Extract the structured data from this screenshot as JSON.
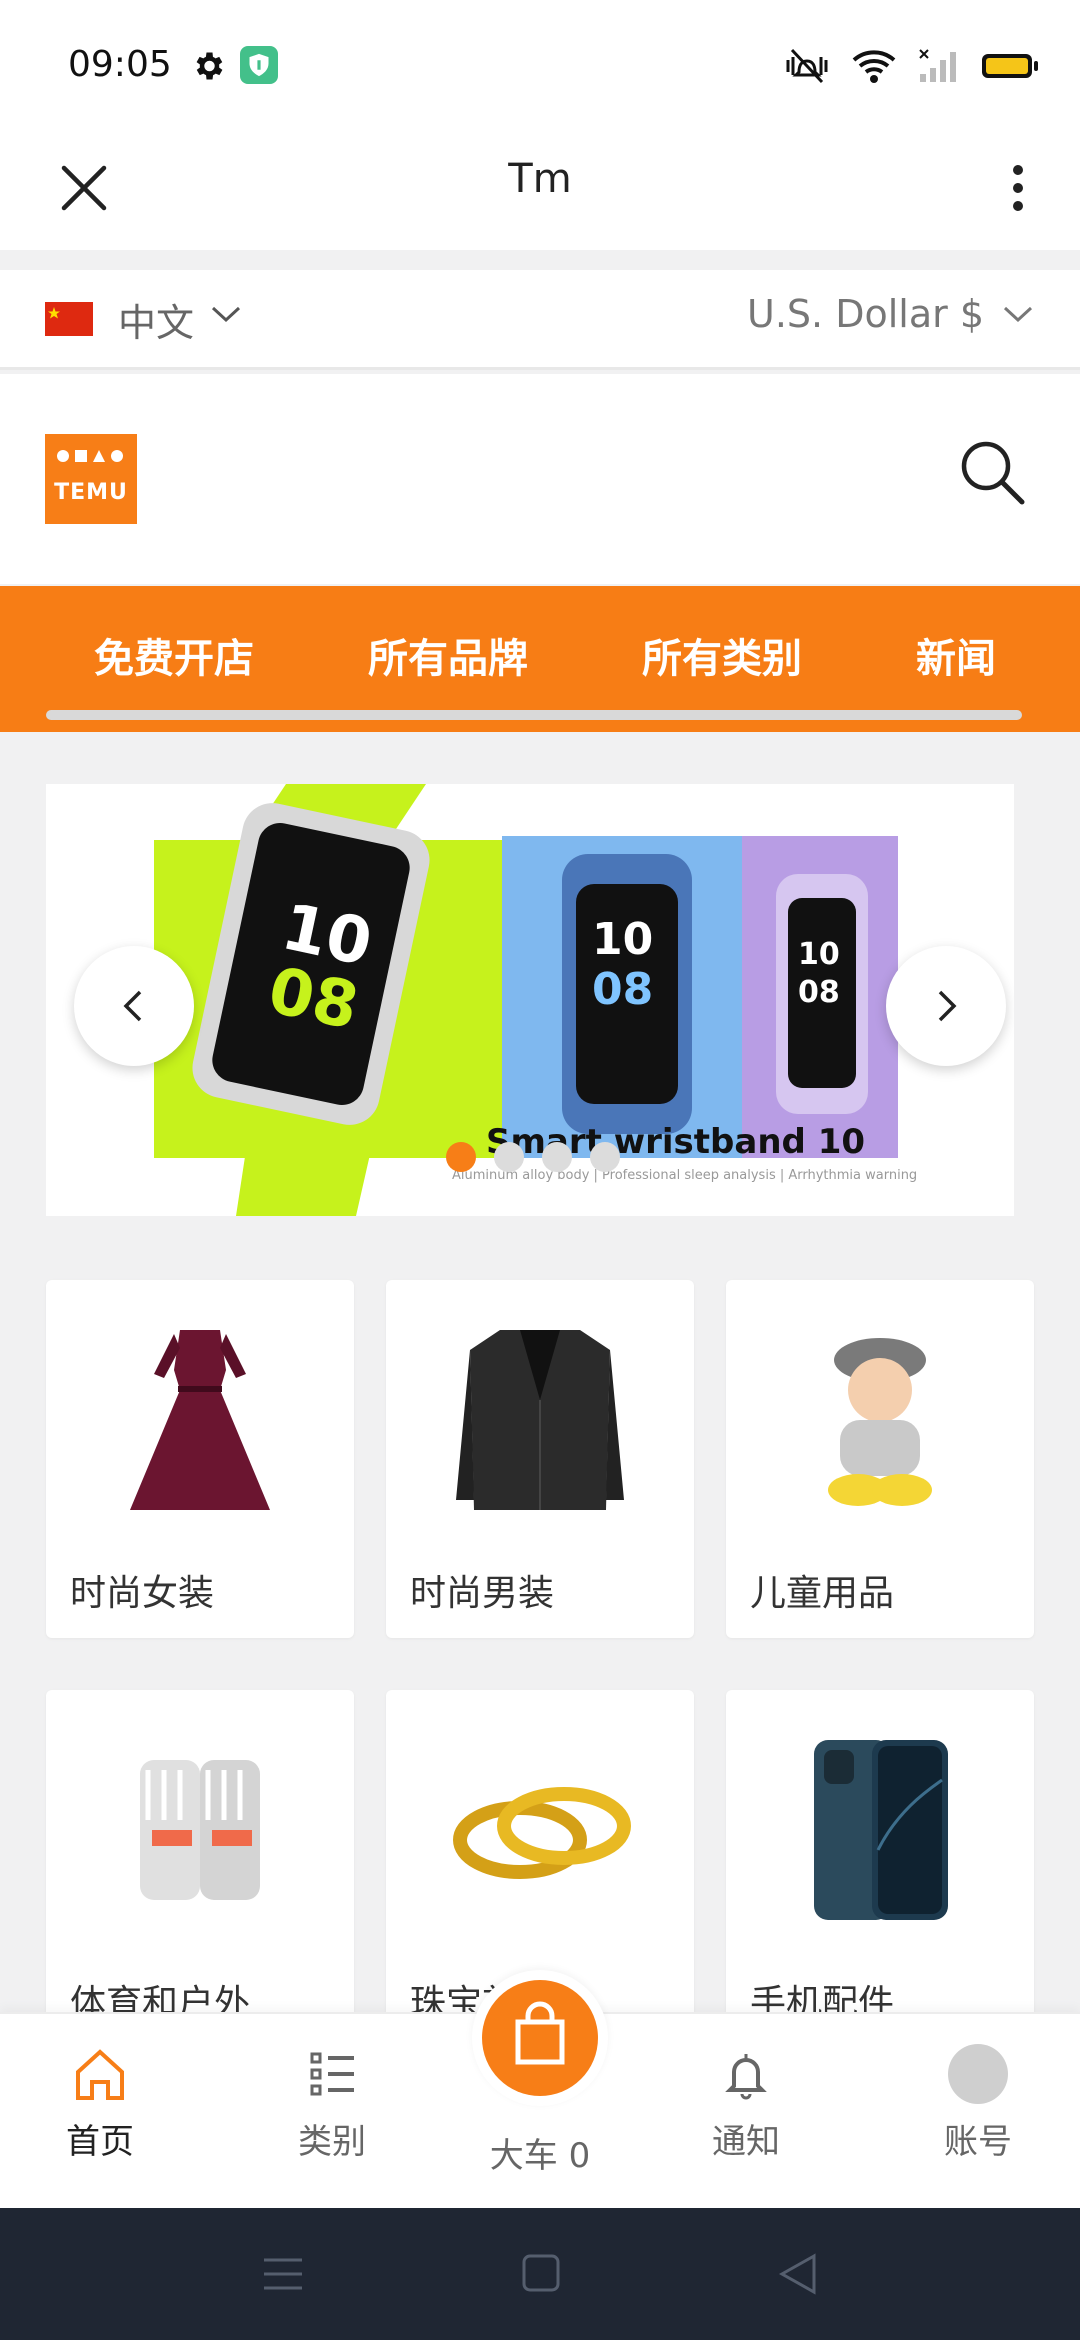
{
  "status_bar": {
    "time": "09:05"
  },
  "topbar": {
    "title": "Tm"
  },
  "locale": {
    "language": "中文",
    "currency": "U.S. Dollar $"
  },
  "brand": {
    "logo_text": "TEMU"
  },
  "nav": {
    "items": [
      "免费开店",
      "所有品牌",
      "所有类别",
      "新闻"
    ]
  },
  "banner": {
    "caption": "Smart wristband 10",
    "subtitle": "Aluminum alloy body | Professional sleep analysis | Arrhythmia warning",
    "slides_count": 4,
    "active_slide": 1
  },
  "categories": [
    {
      "label": "时尚女装",
      "icon": "dress-image"
    },
    {
      "label": "时尚男装",
      "icon": "suit-jacket-image"
    },
    {
      "label": "儿童用品",
      "icon": "baby-image"
    },
    {
      "label": "体育和户外",
      "icon": "gloves-image"
    },
    {
      "label": "珠宝首饰",
      "icon": "rings-image"
    },
    {
      "label": "手机配件",
      "icon": "phone-image"
    }
  ],
  "tabbar": {
    "home": "首页",
    "categories": "类别",
    "cart": "大车 0",
    "notifications": "通知",
    "account": "账号"
  },
  "colors": {
    "accent": "#f77e17",
    "navbar": "#f77d15",
    "sysnav": "#1f2633"
  }
}
